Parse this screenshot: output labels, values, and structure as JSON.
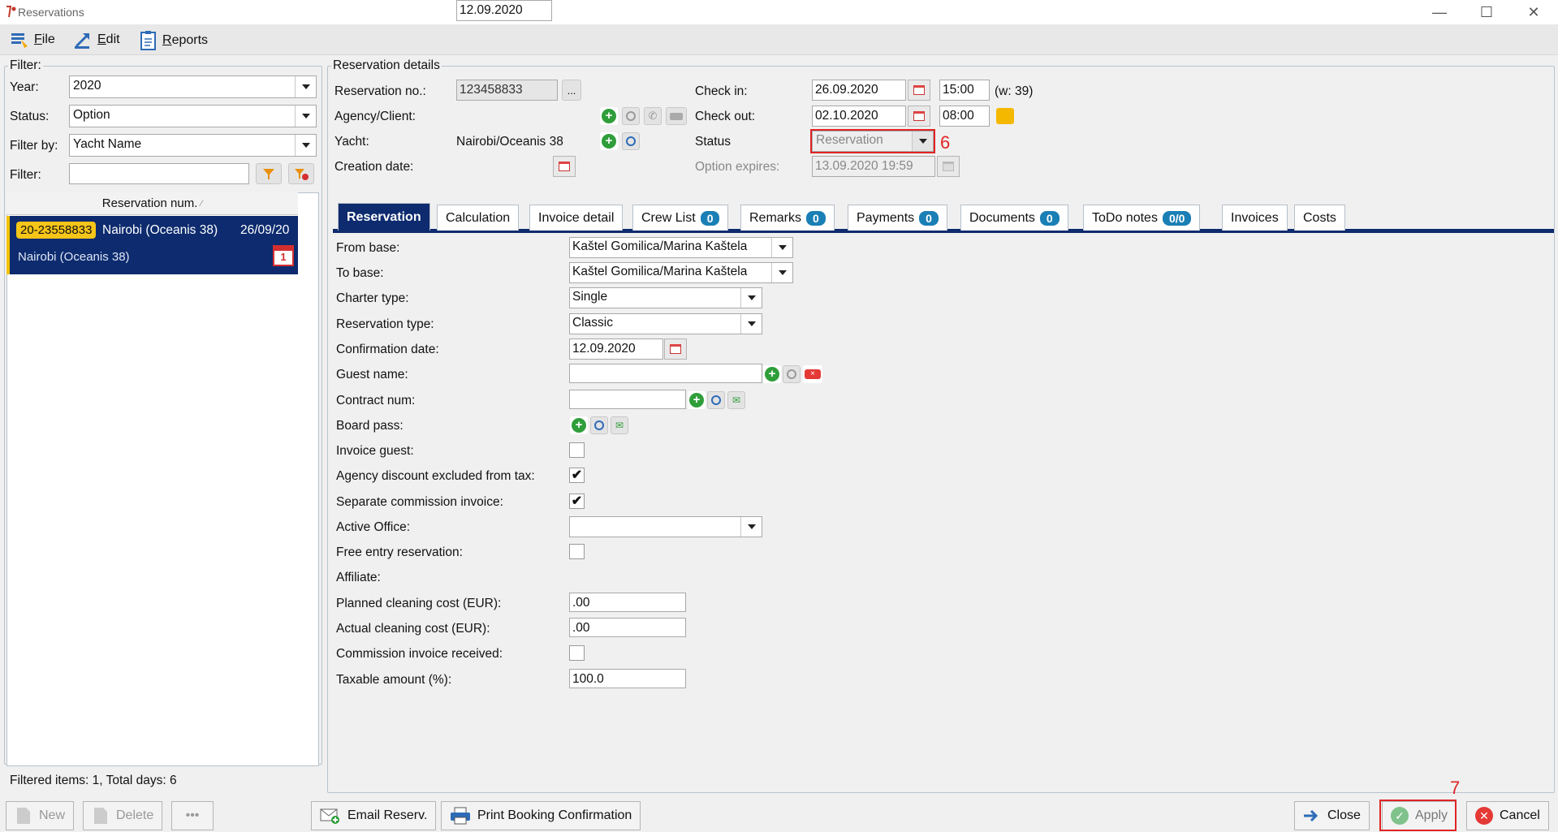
{
  "window": {
    "title": "Reservations",
    "minimize": "—",
    "maximize": "☐",
    "close": "✕"
  },
  "menu": {
    "file_u": "F",
    "file_rest": "ile",
    "edit_u": "E",
    "edit_rest": "dit",
    "reports_u": "R",
    "reports_rest": "eports"
  },
  "filter": {
    "legend": "Filter:",
    "year_label": "Year:",
    "year_value": "2020",
    "status_label": "Status:",
    "status_value": "Option",
    "filter_by_label": "Filter by:",
    "filter_by_value": "Yacht Name",
    "filter_label": "Filter:",
    "filter_value": "",
    "column_header": "Reservation num.",
    "row": {
      "number": "20-23558833",
      "yacht": "Nairobi (Oceanis 38)",
      "date": "26/09/20",
      "subtitle": "Nairobi (Oceanis 38)",
      "cal_day": "1"
    },
    "footer": "Filtered items: 1,  Total days: 6"
  },
  "details": {
    "legend": "Reservation details",
    "res_no_label": "Reservation no.:",
    "res_no_value": "123458833",
    "res_no_btn": "...",
    "agency_label": "Agency/Client:",
    "yacht_label": "Yacht:",
    "yacht_value": "Nairobi/Oceanis 38",
    "creation_label": "Creation date:",
    "creation_value": "12.09.2020",
    "checkin_label": "Check in:",
    "checkin_date": "26.09.2020",
    "checkin_time": "15:00",
    "week": "(w: 39)",
    "checkout_label": "Check out:",
    "checkout_date": "02.10.2020",
    "checkout_time": "08:00",
    "status_label": "Status",
    "status_value": "Reservation",
    "option_label": "Option expires:",
    "option_value": "13.09.2020 19:59",
    "annotation_6": "6"
  },
  "tabs": [
    {
      "label": "Reservation"
    },
    {
      "label": "Calculation"
    },
    {
      "label": "Invoice detail"
    },
    {
      "label": "Crew List",
      "badge": "0"
    },
    {
      "label": "Remarks",
      "badge": "0"
    },
    {
      "label": "Payments",
      "badge": "0"
    },
    {
      "label": "Documents",
      "badge": "0"
    },
    {
      "label": "ToDo notes",
      "badge": "0/0"
    },
    {
      "label": "Invoices"
    },
    {
      "label": "Costs"
    }
  ],
  "form": {
    "from_base_label": "From base:",
    "from_base_value": "Kaštel Gomilica/Marina Kaštela",
    "to_base_label": "To base:",
    "to_base_value": "Kaštel Gomilica/Marina Kaštela",
    "charter_type_label": "Charter type:",
    "charter_type_value": "Single",
    "res_type_label": "Reservation type:",
    "res_type_value": "Classic",
    "conf_date_label": "Confirmation date:",
    "conf_date_value": "12.09.2020",
    "guest_label": "Guest name:",
    "guest_value": "",
    "contract_label": "Contract num:",
    "contract_value": "",
    "board_label": "Board pass:",
    "invoice_guest_label": "Invoice guest:",
    "invoice_guest_checked": "",
    "agency_disc_label": "Agency discount excluded from tax:",
    "agency_disc_checked": "✔",
    "sep_comm_label": "Separate commission invoice:",
    "sep_comm_checked": "✔",
    "active_office_label": "Active Office:",
    "active_office_value": "",
    "free_entry_label": "Free entry reservation:",
    "free_entry_checked": "",
    "affiliate_label": "Affiliate:",
    "planned_label": "Planned cleaning cost (EUR):",
    "planned_value": ".00",
    "actual_label": "Actual cleaning cost (EUR):",
    "actual_value": ".00",
    "comm_recv_label": "Commission invoice received:",
    "comm_recv_checked": "",
    "taxable_label": "Taxable amount (%):",
    "taxable_value": "100.0"
  },
  "buttons": {
    "new": "New",
    "delete": "Delete",
    "more": "•••",
    "email": "Email Reserv.",
    "print": "Print Booking Confirmation",
    "close": "Close",
    "apply": "Apply",
    "cancel": "Cancel",
    "annotation_7": "7"
  }
}
